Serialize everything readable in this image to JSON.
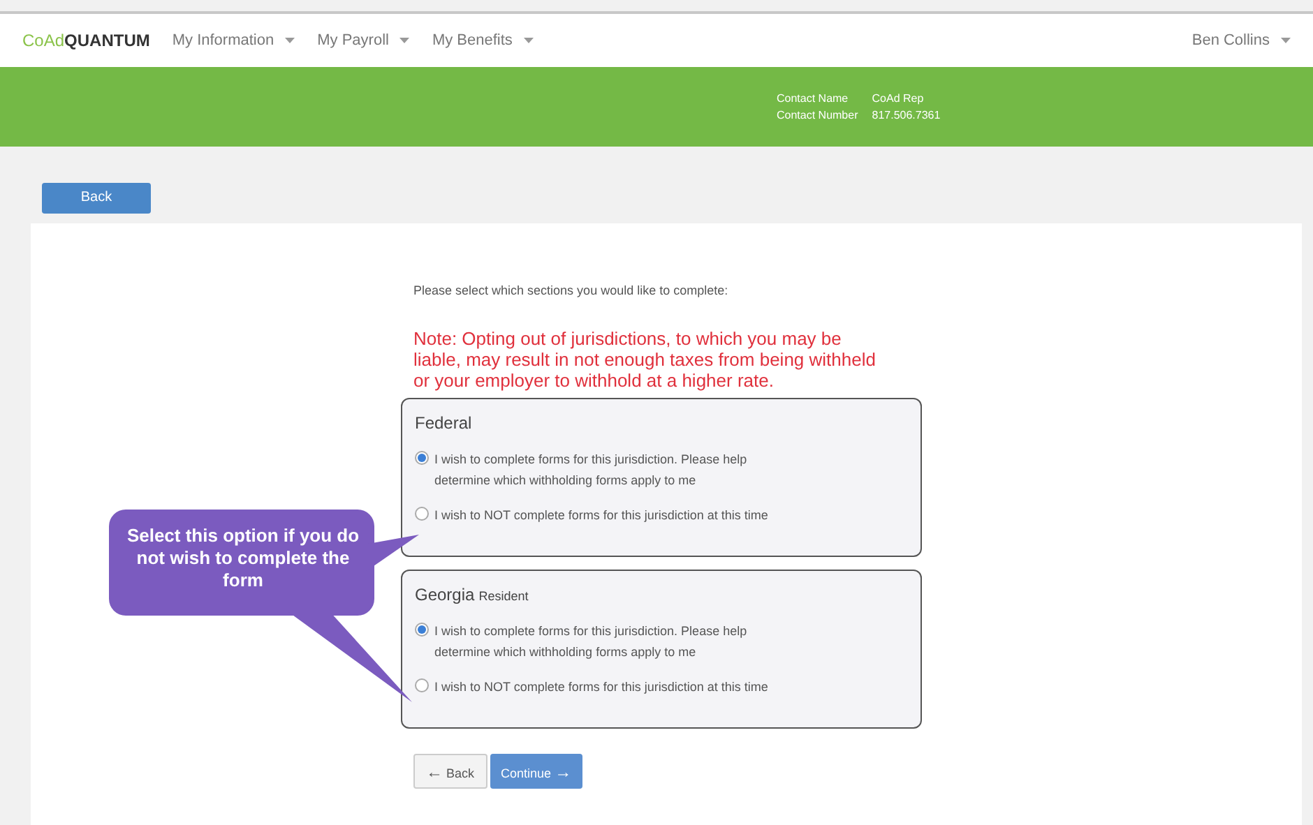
{
  "navbar": {
    "logo_light": "CoAd",
    "logo_bold": "QUANTUM",
    "menus": [
      {
        "label": "My Information"
      },
      {
        "label": "My Payroll"
      },
      {
        "label": "My Benefits"
      }
    ],
    "user": "Ben Collins"
  },
  "banner": {
    "contact": [
      {
        "label": "Contact Name",
        "value": "CoAd Rep"
      },
      {
        "label": "Contact Number",
        "value": "817.506.7361"
      }
    ]
  },
  "top_button": "Back",
  "intro": "Please select which sections you would like to complete:",
  "note": "Note: Opting out of jurisdictions, to which you may be liable, may result in not enough taxes from being withheld or your employer to withhold at a higher rate.",
  "sections": [
    {
      "title": "Federal",
      "options": [
        {
          "label": "I wish to complete forms for this jurisdiction. Please help determine which withholding forms apply to me",
          "selected": true
        },
        {
          "label": "I wish to NOT complete forms for this jurisdiction at this time",
          "selected": false
        }
      ]
    },
    {
      "title": "Georgia",
      "subtitle": "Resident",
      "options": [
        {
          "label": "I wish to complete forms for this jurisdiction. Please help determine which withholding forms apply to me",
          "selected": true
        },
        {
          "label": "I wish to NOT complete forms for this jurisdiction at this time",
          "selected": false
        }
      ]
    }
  ],
  "buttons": [
    {
      "label": "Back",
      "arrow": "←",
      "kind": "back"
    },
    {
      "label": "Continue",
      "arrow": "→",
      "kind": "continue"
    }
  ],
  "callout": "Select this option if you do not wish to complete the form"
}
